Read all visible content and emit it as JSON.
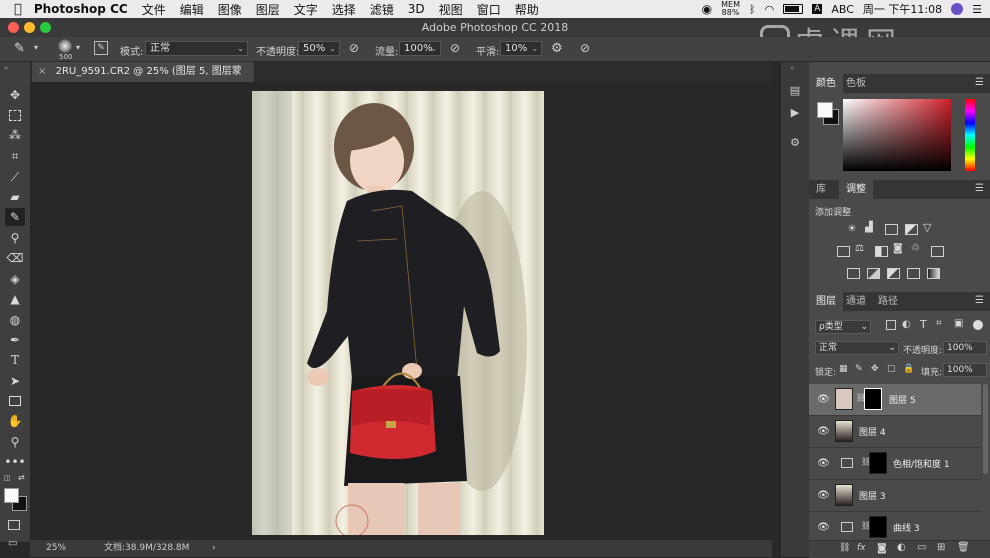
{
  "menubar": {
    "app": "Photoshop CC",
    "items": [
      "文件",
      "编辑",
      "图像",
      "图层",
      "文字",
      "选择",
      "滤镜",
      "3D",
      "视图",
      "窗口",
      "帮助"
    ],
    "status": {
      "mem_label": "MEM",
      "mem_value": "88%",
      "abc": "ABC",
      "clock": "周一 下午11:08"
    }
  },
  "titlebar": {
    "title": "Adobe Photoshop CC 2018"
  },
  "watermark": {
    "text": "虎课网"
  },
  "options": {
    "brush_size": "500",
    "mode_label": "模式:",
    "mode_value": "正常",
    "opacity_label": "不透明度:",
    "opacity_value": "50%",
    "flow_label": "流量:",
    "flow_value": "100%",
    "smooth_label": "平滑:",
    "smooth_value": "10%"
  },
  "document": {
    "tab_title": "2RU_9591.CR2 @ 25% (图层 5, 图层蒙版/8) *"
  },
  "status": {
    "zoom": "25%",
    "doc_info": "文档:38.9M/328.8M",
    "arrow": "›"
  },
  "panels": {
    "color_tabs": [
      "颜色",
      "色板"
    ],
    "lib_tabs": [
      "库",
      "调整"
    ],
    "adj_title": "添加调整",
    "layer_tabs": [
      "图层",
      "通道",
      "路径"
    ],
    "filter_label": "ρ类型",
    "blend_mode": "正常",
    "opacity_label": "不透明度:",
    "opacity_value": "100%",
    "lock_label": "锁定:",
    "fill_label": "填充:",
    "fill_value": "100%"
  },
  "layers": [
    {
      "name": "图层 5",
      "active": true
    },
    {
      "name": "图层 4",
      "active": false
    },
    {
      "name": "色相/饱和度 1",
      "active": false
    },
    {
      "name": "图层 3",
      "active": false
    },
    {
      "name": "曲线 3",
      "active": false
    }
  ],
  "colors": {
    "accent_red": "#d0202a",
    "panel_bg": "#4a4a4a",
    "canvas_bg": "#282828"
  }
}
